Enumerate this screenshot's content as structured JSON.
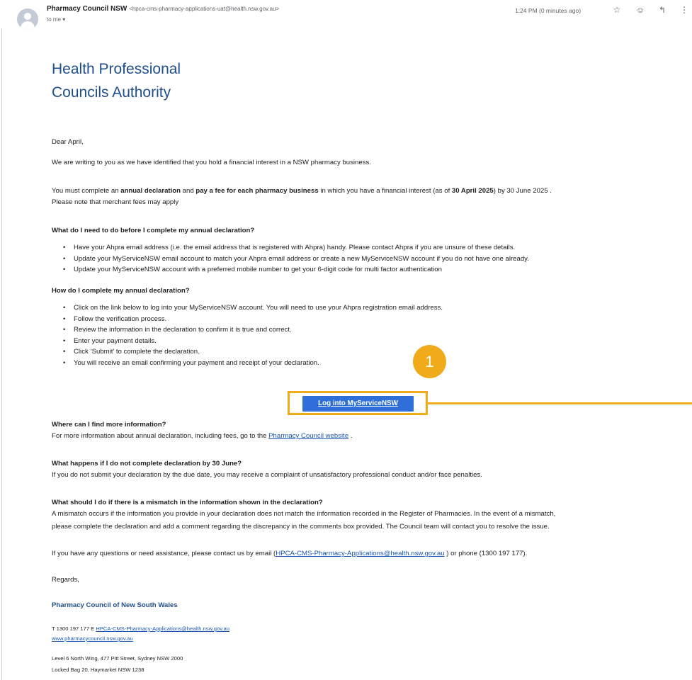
{
  "header": {
    "sender_name": "Pharmacy Council NSW",
    "sender_email": "<hpca-cms-pharmacy-applications-uat@health.nsw.gov.au>",
    "recipient": "to me ▾",
    "timestamp": "1:24 PM (0 minutes ago)",
    "icons": [
      "star-icon",
      "emoji-icon",
      "reply-icon",
      "more-icon"
    ]
  },
  "email": {
    "logo_line1": "Health Professional",
    "logo_line2": "Councils Authority",
    "greeting": "Dear April,",
    "intro": "We are writing to you as we have identified that you hold a financial interest in a NSW pharmacy business.",
    "must_part1": "You must complete an ",
    "must_bold1": "annual declaration",
    "must_part2": " and ",
    "must_bold2": "pay a fee for each pharmacy business",
    "must_part3": " in which you have a financial interest (as of ",
    "must_bold3": "30 April 2025",
    "must_part4": ") by 30 June 2025 .",
    "merchant_note": "Please note that merchant fees may apply",
    "before_heading": "What do I need to do before I complete my annual declaration?",
    "before_items": [
      "Have your Ahpra email address (i.e. the email address that is registered with Ahpra) handy. Please contact Ahpra if you are unsure of these details.",
      "Update your MyServiceNSW email account to match your Ahpra email address or create a new MyServiceNSW account if you do not have one already.",
      "Update your MyServiceNSW account with a preferred mobile number to get your 6-digit code for multi factor authentication"
    ],
    "how_heading": "How do I complete my annual declaration?",
    "how_items": [
      "Click on the link below to log into your MyServiceNSW account. You will need to use your Ahpra registration email address.",
      "Follow the verification process.",
      "Review the information in the declaration to confirm it is true and correct.",
      "Enter your payment details.",
      "Click ‘Submit’ to complete the declaration.",
      "You will receive an email confirming your payment and receipt of your declaration."
    ],
    "cta_label": "Log into MyServiceNSW",
    "more_info_heading": "Where can I find more information?",
    "more_info_text": "For more information about annual declaration, including fees, go to the ",
    "more_info_link": "Pharmacy Council website",
    "more_info_end": " .",
    "late_heading": "What happens if I do not complete declaration by 30 June?",
    "late_text": "If you do not submit your declaration by the due date, you may receive a complaint of unsatisfactory professional conduct and/or face penalties.",
    "mismatch_heading": "What should I do if there is a mismatch in the information shown in the declaration?",
    "mismatch_text1": "A mismatch occurs if the information you provide in your declaration does not match the information recorded in the Register of Pharmacies. In the event of a mismatch,",
    "mismatch_text2": "please complete the declaration and add a comment regarding the discrepancy in the comments box provided. The Council team will contact you to resolve the issue.",
    "contact_part1": "If you have any questions or need assistance, please contact us by email (",
    "contact_email": "HPCA-CMS-Pharmacy-Applications@health.nsw.gov.au",
    "contact_part2": " ) or phone (1300 197 177).",
    "regards": "Regards,",
    "signature_org": "Pharmacy Council of New South Wales",
    "sig_phone_prefix": "T 1300 197 177 E ",
    "sig_email": "HPCA-CMS-Pharmacy-Applications@health.nsw.gov.au",
    "sig_website": "www.pharmacycouncil.nsw.gov.au",
    "address_line1": "Level 6 North Wing, 477 Pitt Street, Sydney NSW 2000",
    "address_line2": "Locked Bag 20, Haymarket NSW 1238"
  },
  "annotation": {
    "step_number": "1",
    "color": "#f0ab1a"
  },
  "colors": {
    "button": "#2e6fd9",
    "link": "#1a56b0",
    "logo": "#1f4e8c"
  }
}
